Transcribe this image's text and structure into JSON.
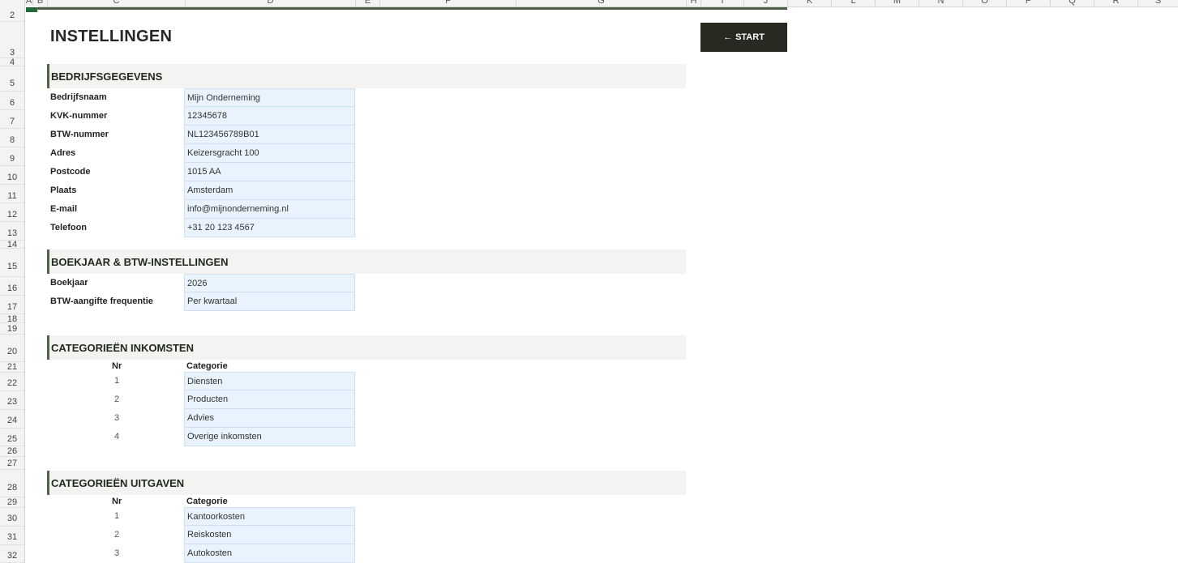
{
  "column_headers": [
    "A",
    "B",
    "C",
    "D",
    "E",
    "F",
    "G",
    "H",
    "I",
    "J",
    "K",
    "L",
    "M",
    "N",
    "O",
    "P",
    "Q",
    "R",
    "S"
  ],
  "row_numbers": [
    "2",
    "3",
    "4",
    "5",
    "6",
    "7",
    "8",
    "9",
    "10",
    "11",
    "12",
    "13",
    "14",
    "15",
    "16",
    "17",
    "18",
    "19",
    "20",
    "21",
    "22",
    "23",
    "24",
    "25",
    "26",
    "27",
    "28",
    "29",
    "30",
    "31",
    "32"
  ],
  "page_title": "INSTELLINGEN",
  "start_button": {
    "arrow": "←",
    "label": "START"
  },
  "sections": {
    "bedrijf": {
      "title": "BEDRIJFSGEGEVENS",
      "rows": [
        {
          "label": "Bedrijfsnaam",
          "value": "Mijn Onderneming"
        },
        {
          "label": "KVK-nummer",
          "value": "12345678"
        },
        {
          "label": "BTW-nummer",
          "value": "NL123456789B01"
        },
        {
          "label": "Adres",
          "value": "Keizersgracht 100"
        },
        {
          "label": "Postcode",
          "value": "1015 AA"
        },
        {
          "label": "Plaats",
          "value": "Amsterdam"
        },
        {
          "label": "E-mail",
          "value": "info@mijnonderneming.nl"
        },
        {
          "label": "Telefoon",
          "value": "+31 20 123 4567"
        }
      ]
    },
    "boekjaar": {
      "title": "BOEKJAAR & BTW-INSTELLINGEN",
      "rows": [
        {
          "label": "Boekjaar",
          "value": "2026"
        },
        {
          "label": "BTW-aangifte frequentie",
          "value": "Per kwartaal"
        }
      ]
    },
    "inkomsten": {
      "title": "CATEGORIEËN INKOMSTEN",
      "col_nr": "Nr",
      "col_cat": "Categorie",
      "rows": [
        {
          "nr": "1",
          "cat": "Diensten"
        },
        {
          "nr": "2",
          "cat": "Producten"
        },
        {
          "nr": "3",
          "cat": "Advies"
        },
        {
          "nr": "4",
          "cat": "Overige inkomsten"
        }
      ]
    },
    "uitgaven": {
      "title": "CATEGORIEËN UITGAVEN",
      "col_nr": "Nr",
      "col_cat": "Categorie",
      "rows": [
        {
          "nr": "1",
          "cat": "Kantoorkosten"
        },
        {
          "nr": "2",
          "cat": "Reiskosten"
        },
        {
          "nr": "3",
          "cat": "Autokosten"
        }
      ]
    }
  },
  "colors": {
    "accent": "#4e6246",
    "input_fill": "#e9f3fd",
    "button": "#262a21",
    "section_fill": "#f4f3f1"
  }
}
